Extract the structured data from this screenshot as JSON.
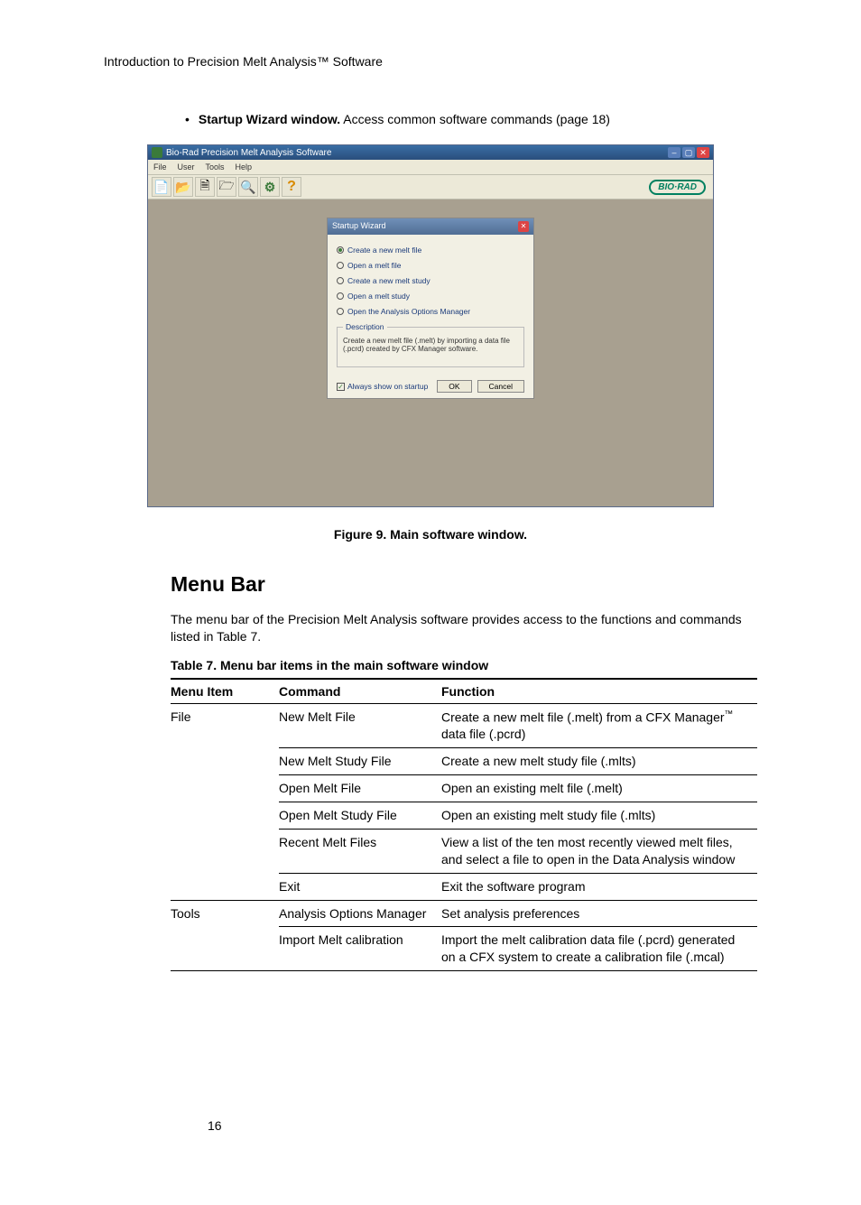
{
  "header": {
    "running": "Introduction to Precision Melt Analysis™ Software"
  },
  "bullet": {
    "lead": "Startup Wizard window.",
    "rest": " Access common software commands (page 18)"
  },
  "app": {
    "title": "Bio-Rad Precision Melt Analysis Software",
    "menus": [
      "File",
      "User",
      "Tools",
      "Help"
    ],
    "logo": "BIO·RAD",
    "wizard": {
      "title": "Startup Wizard",
      "options": [
        "Create a new melt file",
        "Open a melt file",
        "Create a new melt study",
        "Open a melt study",
        "Open the Analysis Options Manager"
      ],
      "desc_legend": "Description",
      "desc_text": "Create a new melt file (.melt) by importing a data file (.pcrd) created by CFX Manager software.",
      "always": "Always show on startup",
      "ok": "OK",
      "cancel": "Cancel"
    }
  },
  "figure_caption": "Figure 9. Main software window.",
  "section_heading": "Menu Bar",
  "section_body": "The menu bar of the Precision Melt Analysis software provides access to the functions and commands listed in Table 7.",
  "table_caption": "Table 7. Menu bar items in the main software window",
  "table": {
    "headers": [
      "Menu Item",
      "Command",
      "Function"
    ],
    "rows": [
      {
        "menu": "File",
        "cmd": "New Melt File",
        "func_pre": "Create a new melt file (.melt) from a CFX Manager",
        "func_sup": "™",
        "func_post": " data file (.pcrd)"
      },
      {
        "menu": "",
        "cmd": "New Melt Study File",
        "func": "Create a new melt study file (.mlts)"
      },
      {
        "menu": "",
        "cmd": "Open Melt File",
        "func": "Open an existing melt file (.melt)"
      },
      {
        "menu": "",
        "cmd": "Open Melt Study File",
        "func": "Open an existing melt study file (.mlts)"
      },
      {
        "menu": "",
        "cmd": "Recent Melt Files",
        "func": "View a list of the ten most recently viewed melt files, and select a file to open in the Data Analysis window"
      },
      {
        "menu": "",
        "cmd": "Exit",
        "func": "Exit the software program"
      },
      {
        "menu": "Tools",
        "cmd": "Analysis Options Manager",
        "func": "Set analysis preferences"
      },
      {
        "menu": "",
        "cmd": "Import Melt calibration",
        "func": "Import the melt calibration data file (.pcrd) generated on a CFX system to create a calibration file (.mcal)"
      }
    ]
  },
  "page_number": "16"
}
